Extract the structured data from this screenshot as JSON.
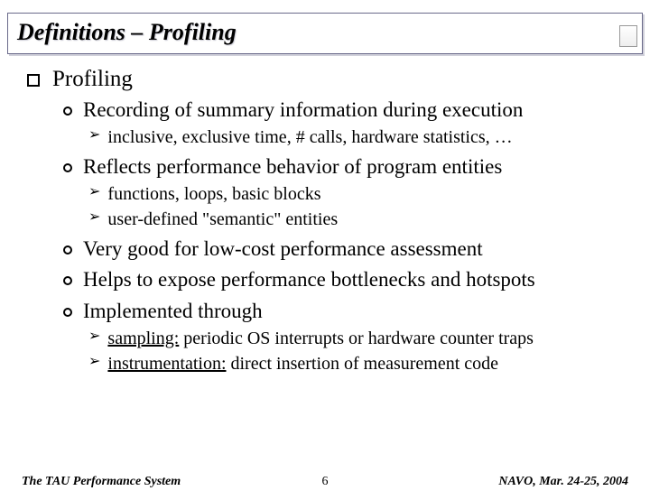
{
  "title": "Definitions – Profiling",
  "section": "Profiling",
  "items": [
    {
      "text": "Recording of summary information during execution",
      "sub": [
        {
          "text": "inclusive, exclusive time, # calls, hardware statistics, …"
        }
      ]
    },
    {
      "text": "Reflects performance behavior of program entities",
      "sub": [
        {
          "text": "functions, loops, basic blocks"
        },
        {
          "text": "user-defined \"semantic\" entities"
        }
      ]
    },
    {
      "text": "Very good for low-cost performance assessment",
      "sub": []
    },
    {
      "text": "Helps to expose performance bottlenecks and hotspots",
      "sub": []
    },
    {
      "text": "Implemented through",
      "sub": [
        {
          "lead": "sampling:",
          "rest": " periodic OS interrupts or hardware counter traps"
        },
        {
          "lead": "instrumentation:",
          "rest": " direct insertion of measurement code"
        }
      ]
    }
  ],
  "footer": {
    "left": "The TAU Performance System",
    "center": "6",
    "right": "NAVO, Mar. 24-25, 2004"
  }
}
